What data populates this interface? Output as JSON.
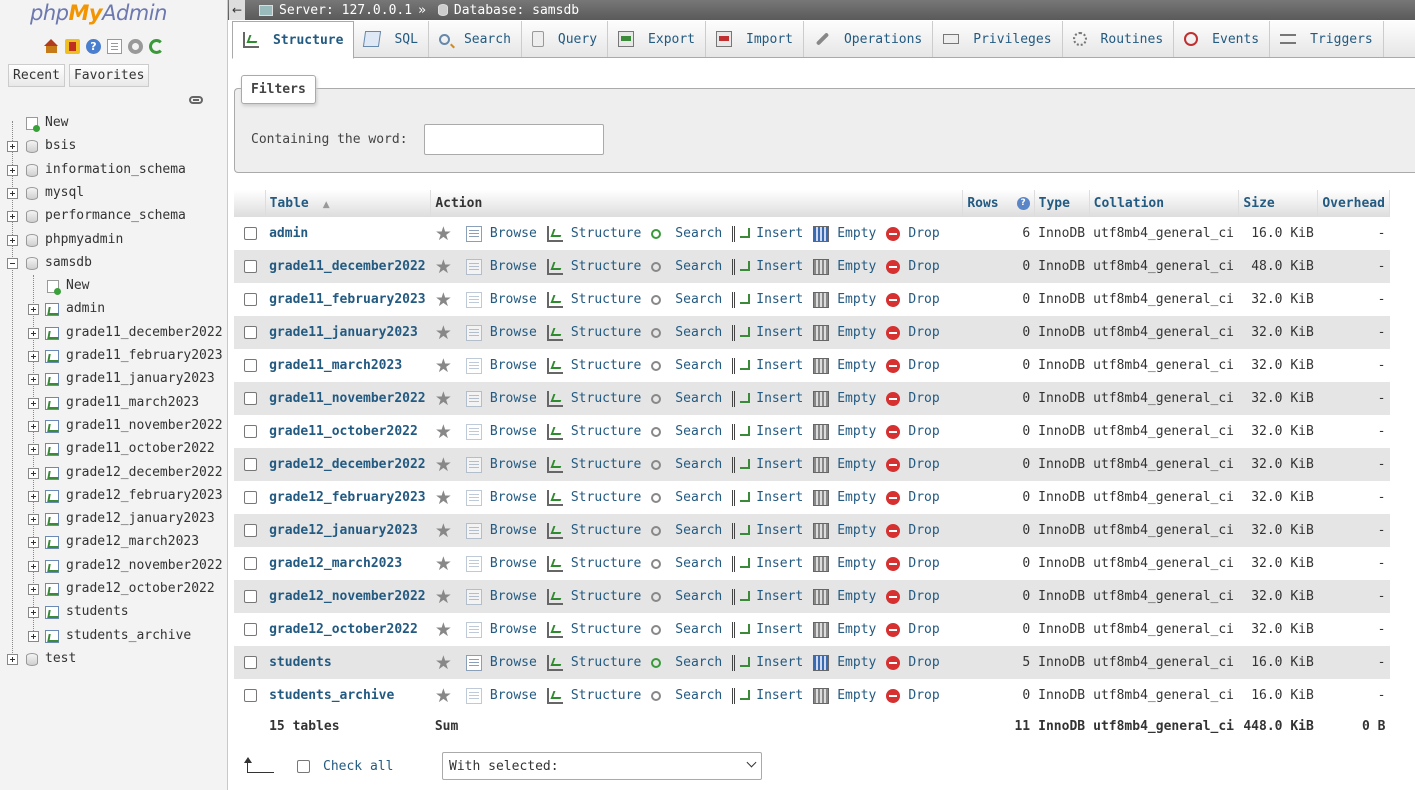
{
  "logo": {
    "php": "php",
    "my": "My",
    "admin": "Admin"
  },
  "nav": {
    "tabs": [
      "Recent",
      "Favorites"
    ],
    "tree": [
      {
        "label": "New",
        "kind": "new",
        "level": 0
      },
      {
        "label": "bsis",
        "kind": "db",
        "level": 0
      },
      {
        "label": "information_schema",
        "kind": "db",
        "level": 0
      },
      {
        "label": "mysql",
        "kind": "db",
        "level": 0
      },
      {
        "label": "performance_schema",
        "kind": "db",
        "level": 0
      },
      {
        "label": "phpmyadmin",
        "kind": "db",
        "level": 0
      },
      {
        "label": "samsdb",
        "kind": "db-open",
        "level": 0
      },
      {
        "label": "New",
        "kind": "new",
        "level": 1
      },
      {
        "label": "admin",
        "kind": "table",
        "level": 1
      },
      {
        "label": "grade11_december2022",
        "kind": "table",
        "level": 1
      },
      {
        "label": "grade11_february2023",
        "kind": "table",
        "level": 1
      },
      {
        "label": "grade11_january2023",
        "kind": "table",
        "level": 1
      },
      {
        "label": "grade11_march2023",
        "kind": "table",
        "level": 1
      },
      {
        "label": "grade11_november2022",
        "kind": "table",
        "level": 1
      },
      {
        "label": "grade11_october2022",
        "kind": "table",
        "level": 1
      },
      {
        "label": "grade12_december2022",
        "kind": "table",
        "level": 1
      },
      {
        "label": "grade12_february2023",
        "kind": "table",
        "level": 1
      },
      {
        "label": "grade12_january2023",
        "kind": "table",
        "level": 1
      },
      {
        "label": "grade12_march2023",
        "kind": "table",
        "level": 1
      },
      {
        "label": "grade12_november2022",
        "kind": "table",
        "level": 1
      },
      {
        "label": "grade12_october2022",
        "kind": "table",
        "level": 1
      },
      {
        "label": "students",
        "kind": "table",
        "level": 1
      },
      {
        "label": "students_archive",
        "kind": "table",
        "level": 1
      },
      {
        "label": "test",
        "kind": "db",
        "level": 0
      }
    ]
  },
  "topbar": {
    "back": "←",
    "server": "Server: 127.0.0.1",
    "sep": "»",
    "database": "Database: samsdb"
  },
  "menu": [
    {
      "label": "Structure",
      "icon": "structure-icon",
      "active": true
    },
    {
      "label": "SQL",
      "icon": "sql-icon"
    },
    {
      "label": "Search",
      "icon": "search-icon"
    },
    {
      "label": "Query",
      "icon": "query-icon"
    },
    {
      "label": "Export",
      "icon": "export-icon"
    },
    {
      "label": "Import",
      "icon": "import-icon"
    },
    {
      "label": "Operations",
      "icon": "operations-icon"
    },
    {
      "label": "Privileges",
      "icon": "privileges-icon"
    },
    {
      "label": "Routines",
      "icon": "routines-icon"
    },
    {
      "label": "Events",
      "icon": "events-icon"
    },
    {
      "label": "Triggers",
      "icon": "triggers-icon"
    }
  ],
  "filters": {
    "legend": "Filters",
    "label": "Containing the word:",
    "value": ""
  },
  "table": {
    "headers": {
      "table": "Table",
      "sort": "▲",
      "action": "Action",
      "rows": "Rows",
      "info": "?",
      "type": "Type",
      "collation": "Collation",
      "size": "Size",
      "overhead": "Overhead"
    },
    "action_labels": {
      "browse": "Browse",
      "structure": "Structure",
      "search": "Search",
      "insert": "Insert",
      "empty": "Empty",
      "drop": "Drop"
    },
    "rows": [
      {
        "name": "admin",
        "rows": "6",
        "type": "InnoDB",
        "collation": "utf8mb4_general_ci",
        "size": "16.0 KiB",
        "overhead": "-",
        "has_data": true
      },
      {
        "name": "grade11_december2022",
        "rows": "0",
        "type": "InnoDB",
        "collation": "utf8mb4_general_ci",
        "size": "48.0 KiB",
        "overhead": "-",
        "has_data": false
      },
      {
        "name": "grade11_february2023",
        "rows": "0",
        "type": "InnoDB",
        "collation": "utf8mb4_general_ci",
        "size": "32.0 KiB",
        "overhead": "-",
        "has_data": false
      },
      {
        "name": "grade11_january2023",
        "rows": "0",
        "type": "InnoDB",
        "collation": "utf8mb4_general_ci",
        "size": "32.0 KiB",
        "overhead": "-",
        "has_data": false
      },
      {
        "name": "grade11_march2023",
        "rows": "0",
        "type": "InnoDB",
        "collation": "utf8mb4_general_ci",
        "size": "32.0 KiB",
        "overhead": "-",
        "has_data": false
      },
      {
        "name": "grade11_november2022",
        "rows": "0",
        "type": "InnoDB",
        "collation": "utf8mb4_general_ci",
        "size": "32.0 KiB",
        "overhead": "-",
        "has_data": false
      },
      {
        "name": "grade11_october2022",
        "rows": "0",
        "type": "InnoDB",
        "collation": "utf8mb4_general_ci",
        "size": "32.0 KiB",
        "overhead": "-",
        "has_data": false
      },
      {
        "name": "grade12_december2022",
        "rows": "0",
        "type": "InnoDB",
        "collation": "utf8mb4_general_ci",
        "size": "32.0 KiB",
        "overhead": "-",
        "has_data": false
      },
      {
        "name": "grade12_february2023",
        "rows": "0",
        "type": "InnoDB",
        "collation": "utf8mb4_general_ci",
        "size": "32.0 KiB",
        "overhead": "-",
        "has_data": false
      },
      {
        "name": "grade12_january2023",
        "rows": "0",
        "type": "InnoDB",
        "collation": "utf8mb4_general_ci",
        "size": "32.0 KiB",
        "overhead": "-",
        "has_data": false
      },
      {
        "name": "grade12_march2023",
        "rows": "0",
        "type": "InnoDB",
        "collation": "utf8mb4_general_ci",
        "size": "32.0 KiB",
        "overhead": "-",
        "has_data": false
      },
      {
        "name": "grade12_november2022",
        "rows": "0",
        "type": "InnoDB",
        "collation": "utf8mb4_general_ci",
        "size": "32.0 KiB",
        "overhead": "-",
        "has_data": false
      },
      {
        "name": "grade12_october2022",
        "rows": "0",
        "type": "InnoDB",
        "collation": "utf8mb4_general_ci",
        "size": "32.0 KiB",
        "overhead": "-",
        "has_data": false
      },
      {
        "name": "students",
        "rows": "5",
        "type": "InnoDB",
        "collation": "utf8mb4_general_ci",
        "size": "16.0 KiB",
        "overhead": "-",
        "has_data": true
      },
      {
        "name": "students_archive",
        "rows": "0",
        "type": "InnoDB",
        "collation": "utf8mb4_general_ci",
        "size": "16.0 KiB",
        "overhead": "-",
        "has_data": false
      }
    ],
    "footer": {
      "count": "15 tables",
      "sum": "Sum",
      "rows": "11",
      "type": "InnoDB",
      "collation": "utf8mb4_general_ci",
      "size": "448.0 KiB",
      "overhead": "0 B"
    }
  },
  "bottom": {
    "check_all": "Check all",
    "with_selected": "With selected:"
  }
}
